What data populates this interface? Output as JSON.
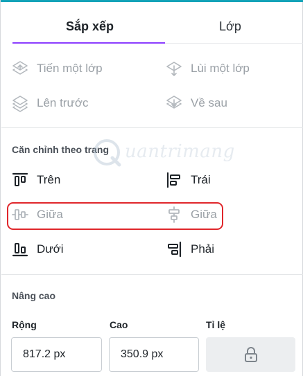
{
  "tabs": {
    "arrange": "Sắp xếp",
    "layers": "Lớp"
  },
  "order": {
    "forward": "Tiến một lớp",
    "backward": "Lùi một lớp",
    "to_front": "Lên trước",
    "to_back": "Về sau"
  },
  "align": {
    "section_title": "Căn chỉnh theo trang",
    "top": "Trên",
    "left": "Trái",
    "middle": "Giữa",
    "center": "Giữa",
    "bottom": "Dưới",
    "right": "Phải"
  },
  "watermark": {
    "text": "uantrimang"
  },
  "advanced": {
    "section_title": "Nâng cao",
    "width_label": "Rộng",
    "width_value": "817.2 px",
    "height_label": "Cao",
    "height_value": "350.9 px",
    "ratio_label": "Tỉ lệ"
  },
  "colors": {
    "accent": "#8b3dff",
    "highlight": "#e0262b",
    "disabled": "#9aa0a6"
  }
}
